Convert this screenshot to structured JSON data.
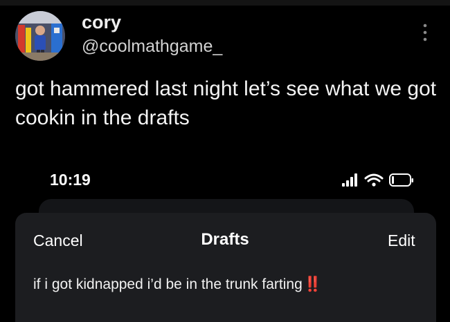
{
  "tweet": {
    "author": {
      "display_name": "cory",
      "handle": "@coolmathgame_",
      "avatar_icon": "profile-photo"
    },
    "more_icon": "vertical-ellipsis-icon",
    "text": "got hammered last night let’s see what we got cookin in the drafts"
  },
  "phone_screenshot": {
    "status_bar": {
      "time": "10:19",
      "icons": [
        "cellular-signal-icon",
        "wifi-icon",
        "battery-icon"
      ]
    },
    "drafts_sheet": {
      "cancel_label": "Cancel",
      "title": "Drafts",
      "edit_label": "Edit",
      "items": [
        {
          "text": "if i got kidnapped i’d be in the trunk farting",
          "emoji": "‼️"
        }
      ]
    }
  },
  "colors": {
    "background": "#000000",
    "sheet_background": "#1c1d20",
    "text_primary": "#ffffff",
    "text_secondary": "#d2d2d2",
    "emoji_red": "#e4222c"
  }
}
